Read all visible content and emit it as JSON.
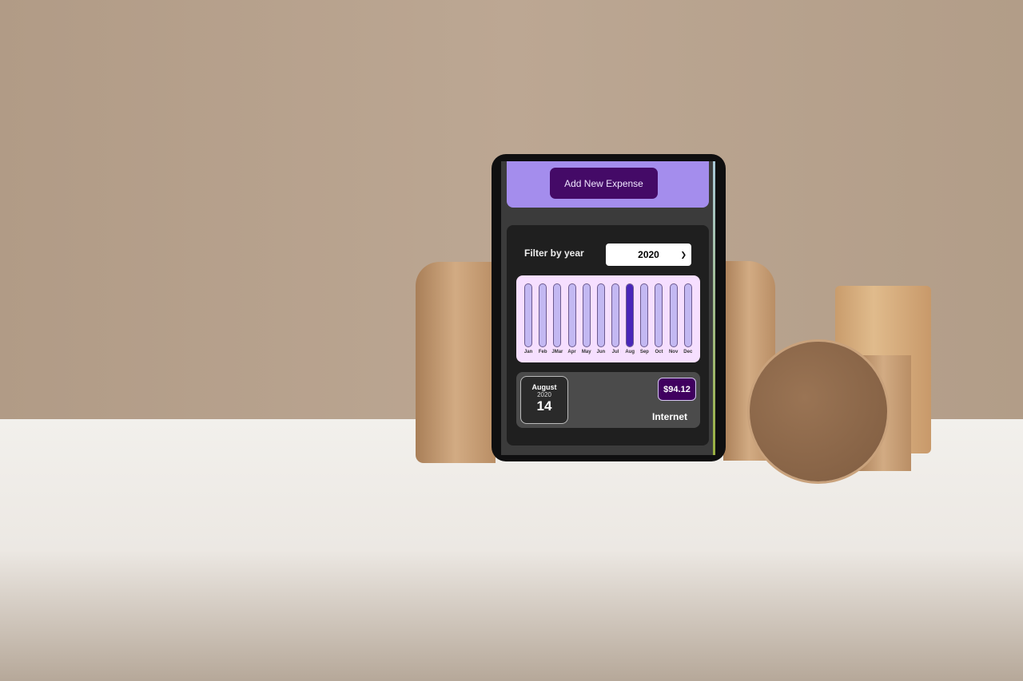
{
  "header": {
    "add_button_label": "Add New Expense"
  },
  "filter": {
    "label": "Filter by year",
    "selected_year": "2020"
  },
  "chart_data": {
    "type": "bar",
    "categories": [
      "Jan",
      "Feb",
      "JMar",
      "Apr",
      "May",
      "Jun",
      "Jul",
      "Aug",
      "Sep",
      "Oct",
      "Nov",
      "Dec"
    ],
    "values": [
      0,
      0,
      0,
      0,
      0,
      0,
      0,
      94.12,
      0,
      0,
      0,
      0
    ],
    "ylim": [
      0,
      94.12
    ],
    "colors": {
      "track": "#c3b8f2",
      "fill": "#4826b9",
      "background": "#f6dfff"
    }
  },
  "expenses": [
    {
      "month": "August",
      "year": "2020",
      "day": "14",
      "amount": "$94.12",
      "title": "Internet"
    }
  ],
  "colors": {
    "header": "#a48ded",
    "button": "#440a67",
    "panel": "#1f1f1f"
  }
}
